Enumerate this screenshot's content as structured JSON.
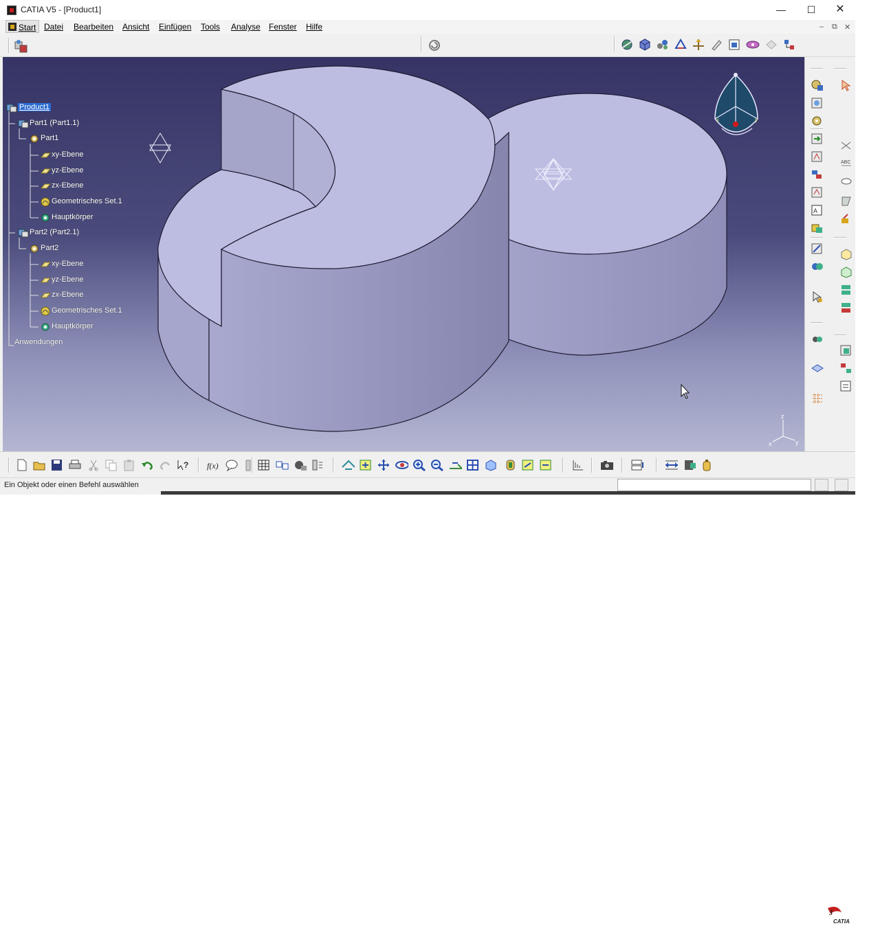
{
  "window": {
    "title": "CATIA V5 - [Product1]",
    "minimize_glyph": "—",
    "maximize_glyph": "☐",
    "close_glyph": "✕"
  },
  "menu": {
    "items": [
      {
        "label": "Start"
      },
      {
        "label": "Datei"
      },
      {
        "label": "Bearbeiten"
      },
      {
        "label": "Ansicht"
      },
      {
        "label": "Einfügen"
      },
      {
        "label": "Tools"
      },
      {
        "label": "Analyse"
      },
      {
        "label": "Fenster"
      },
      {
        "label": "Hilfe"
      }
    ],
    "doc_controls": [
      "–",
      "⧉",
      "✕"
    ]
  },
  "tree": {
    "root": "Product1",
    "part1_instance": "Part1 (Part1.1)",
    "part1": "Part1",
    "part1_children": [
      "xy-Ebene",
      "yz-Ebene",
      "zx-Ebene",
      "Geometrisches Set.1",
      "Hauptkörper"
    ],
    "part2_instance": "Part2 (Part2.1)",
    "part2": "Part2",
    "part2_children": [
      "xy-Ebene",
      "yz-Ebene",
      "zx-Ebene",
      "Geometrisches Set.1",
      "Hauptkörper"
    ],
    "applications": "Anwendungen"
  },
  "compass": {
    "x_label": "x",
    "y_label": "y",
    "z_label": "z"
  },
  "axis": {
    "z": "z",
    "x": "x",
    "y": "y"
  },
  "status": {
    "message": "Ein Objekt oder einen Befehl auswählen",
    "command_value": ""
  },
  "brand": {
    "logo_text": "CATIA"
  },
  "colors": {
    "viewport_top": "#363465",
    "viewport_bottom": "#b4b6d2",
    "solid_top_face": "#bdbde2",
    "solid_side_face": "#9c9cc4",
    "selection": "#2b6bd1"
  }
}
